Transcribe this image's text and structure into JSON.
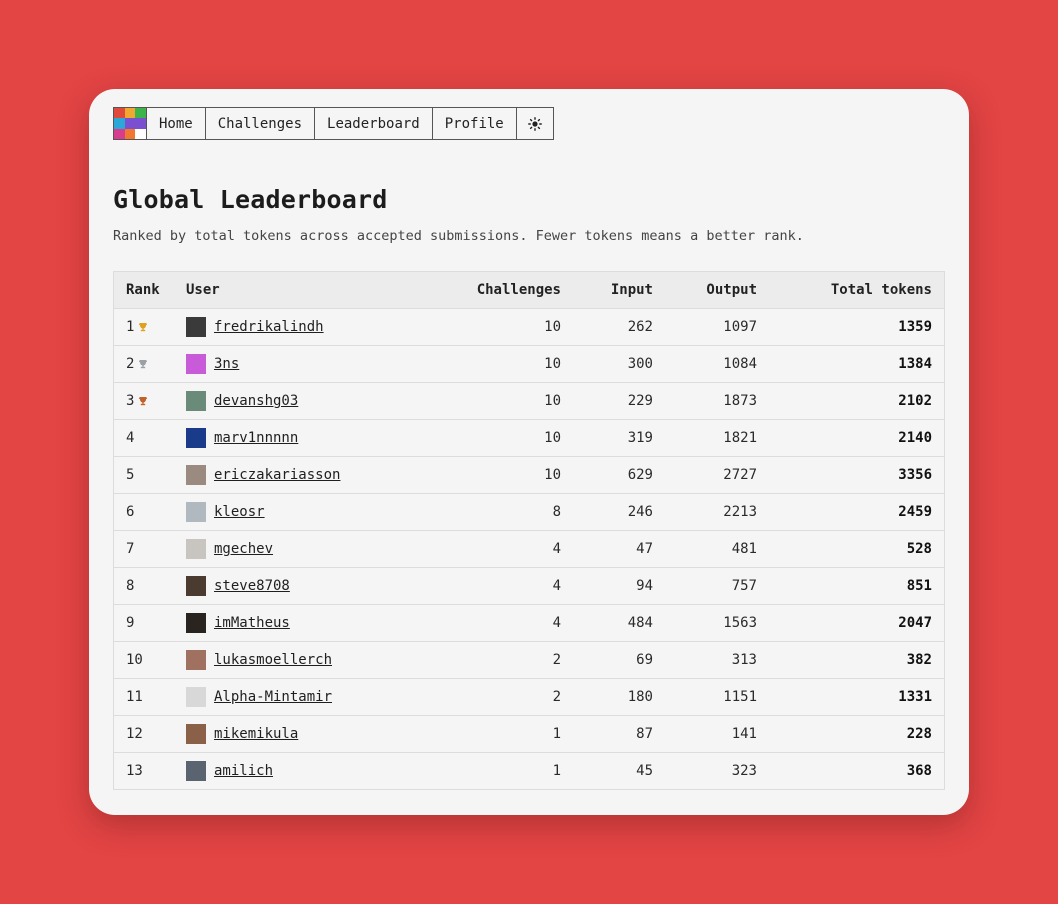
{
  "nav": {
    "items": [
      {
        "label": "Home"
      },
      {
        "label": "Challenges"
      },
      {
        "label": "Leaderboard"
      },
      {
        "label": "Profile"
      }
    ],
    "theme_icon": "sun-icon",
    "logo_colors": [
      "#e04a3a",
      "#f0a830",
      "#3cb44a",
      "#2aa8d8",
      "#7a4fd0",
      "#7a4fd0",
      "#d83c8c",
      "#f07830",
      "#ffffff"
    ]
  },
  "page": {
    "title": "Global Leaderboard",
    "subtitle": "Ranked by total tokens across accepted submissions. Fewer tokens means a better rank."
  },
  "table": {
    "headers": {
      "rank": "Rank",
      "user": "User",
      "challenges": "Challenges",
      "input": "Input",
      "output": "Output",
      "total": "Total tokens"
    },
    "rows": [
      {
        "rank": "1",
        "trophy": "gold",
        "user": "fredrikalindh",
        "challenges": "10",
        "input": "262",
        "output": "1097",
        "total": "1359",
        "avatar": "#3a3a3a"
      },
      {
        "rank": "2",
        "trophy": "silver",
        "user": "3ns",
        "challenges": "10",
        "input": "300",
        "output": "1084",
        "total": "1384",
        "avatar": "#c85bd8"
      },
      {
        "rank": "3",
        "trophy": "bronze",
        "user": "devanshg03",
        "challenges": "10",
        "input": "229",
        "output": "1873",
        "total": "2102",
        "avatar": "#6a8a7a"
      },
      {
        "rank": "4",
        "trophy": "",
        "user": "marv1nnnnn",
        "challenges": "10",
        "input": "319",
        "output": "1821",
        "total": "2140",
        "avatar": "#1a3a8a"
      },
      {
        "rank": "5",
        "trophy": "",
        "user": "ericzakariasson",
        "challenges": "10",
        "input": "629",
        "output": "2727",
        "total": "3356",
        "avatar": "#9a8a80"
      },
      {
        "rank": "6",
        "trophy": "",
        "user": "kleosr",
        "challenges": "8",
        "input": "246",
        "output": "2213",
        "total": "2459",
        "avatar": "#b0b8c0"
      },
      {
        "rank": "7",
        "trophy": "",
        "user": "mgechev",
        "challenges": "4",
        "input": "47",
        "output": "481",
        "total": "528",
        "avatar": "#c8c4c0"
      },
      {
        "rank": "8",
        "trophy": "",
        "user": "steve8708",
        "challenges": "4",
        "input": "94",
        "output": "757",
        "total": "851",
        "avatar": "#4a3a30"
      },
      {
        "rank": "9",
        "trophy": "",
        "user": "imMatheus",
        "challenges": "4",
        "input": "484",
        "output": "1563",
        "total": "2047",
        "avatar": "#2a2420"
      },
      {
        "rank": "10",
        "trophy": "",
        "user": "lukasmoellerch",
        "challenges": "2",
        "input": "69",
        "output": "313",
        "total": "382",
        "avatar": "#a07060"
      },
      {
        "rank": "11",
        "trophy": "",
        "user": "Alpha-Mintamir",
        "challenges": "2",
        "input": "180",
        "output": "1151",
        "total": "1331",
        "avatar": "#d8d8d8"
      },
      {
        "rank": "12",
        "trophy": "",
        "user": "mikemikula",
        "challenges": "1",
        "input": "87",
        "output": "141",
        "total": "228",
        "avatar": "#8a6048"
      },
      {
        "rank": "13",
        "trophy": "",
        "user": "amilich",
        "challenges": "1",
        "input": "45",
        "output": "323",
        "total": "368",
        "avatar": "#5a6470"
      }
    ]
  },
  "colors": {
    "background": "#e34444",
    "card": "#f4f5f4",
    "trophy_gold": "#e0a020",
    "trophy_silver": "#9aa0a6",
    "trophy_bronze": "#c0622a"
  }
}
